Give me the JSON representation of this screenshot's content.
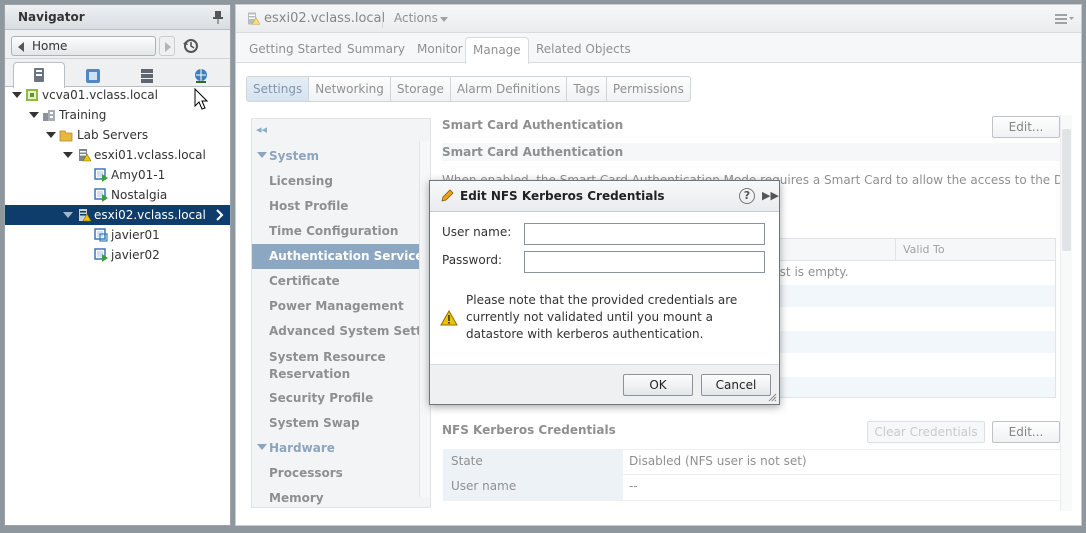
{
  "navigator": {
    "title": "Navigator",
    "home_label": "Home",
    "tabs": [
      "hosts-and-clusters",
      "vms-and-templates",
      "storage",
      "networking"
    ],
    "tree": [
      {
        "label": "vcva01.vclass.local",
        "icon": "vcenter-icon",
        "expanded": true
      },
      {
        "label": "Training",
        "icon": "datacenter-icon",
        "expanded": true
      },
      {
        "label": "Lab Servers",
        "icon": "folder-icon",
        "expanded": true
      },
      {
        "label": "esxi01.vclass.local",
        "icon": "host-warning-icon",
        "expanded": true
      },
      {
        "label": "Amy01-1",
        "icon": "vm-running-icon"
      },
      {
        "label": "Nostalgia",
        "icon": "vm-running-icon"
      },
      {
        "label": "esxi02.vclass.local",
        "icon": "host-warning-icon",
        "expanded": true,
        "selected": true
      },
      {
        "label": "javier01",
        "icon": "vm-icon"
      },
      {
        "label": "javier02",
        "icon": "vm-running-icon"
      }
    ]
  },
  "header": {
    "object_title": "esxi02.vclass.local",
    "actions_label": "Actions"
  },
  "tabs": [
    "Getting Started",
    "Summary",
    "Monitor",
    "Manage",
    "Related Objects"
  ],
  "active_tab": "Manage",
  "subtabs": [
    "Settings",
    "Networking",
    "Storage",
    "Alarm Definitions",
    "Tags",
    "Permissions"
  ],
  "active_subtab": "Settings",
  "settings_list": {
    "sections": [
      {
        "label": "System",
        "type": "header"
      },
      {
        "label": "Licensing"
      },
      {
        "label": "Host Profile"
      },
      {
        "label": "Time Configuration"
      },
      {
        "label": "Authentication Services",
        "selected": true
      },
      {
        "label": "Certificate"
      },
      {
        "label": "Power Management"
      },
      {
        "label": "Advanced System Settings"
      },
      {
        "label": "System Resource Reservation"
      },
      {
        "label": "Security Profile"
      },
      {
        "label": "System Swap"
      },
      {
        "label": "Hardware",
        "type": "header"
      },
      {
        "label": "Processors"
      },
      {
        "label": "Memory"
      }
    ]
  },
  "content": {
    "smart_card_top": "Smart Card Authentication",
    "edit_label": "Edit...",
    "smart_card_section": "Smart Card Authentication",
    "smart_card_desc": "When enabled, the Smart Card Authentication Mode requires a Smart Card to allow the access to the Direct",
    "table_col_valid_to": "Valid To",
    "table_empty": "list is empty.",
    "nfs_section": "NFS Kerberos Credentials",
    "clear_credentials_label": "Clear Credentials",
    "nfs_rows": [
      {
        "key": "State",
        "value": "Disabled (NFS user is not set)"
      },
      {
        "key": "User name",
        "value": "--"
      }
    ]
  },
  "dialog": {
    "title": "Edit NFS Kerberos Credentials",
    "username_label": "User name:",
    "username_value": "",
    "password_label": "Password:",
    "password_value": "",
    "note": "Please note that the provided credentials are currently not validated until you mount a datastore with kerberos authentication.",
    "ok_label": "OK",
    "cancel_label": "Cancel",
    "help_glyph": "?"
  },
  "colors": {
    "selection": "#0f3d6b",
    "accent": "#2f5f8f",
    "warning": "#f2c200"
  }
}
